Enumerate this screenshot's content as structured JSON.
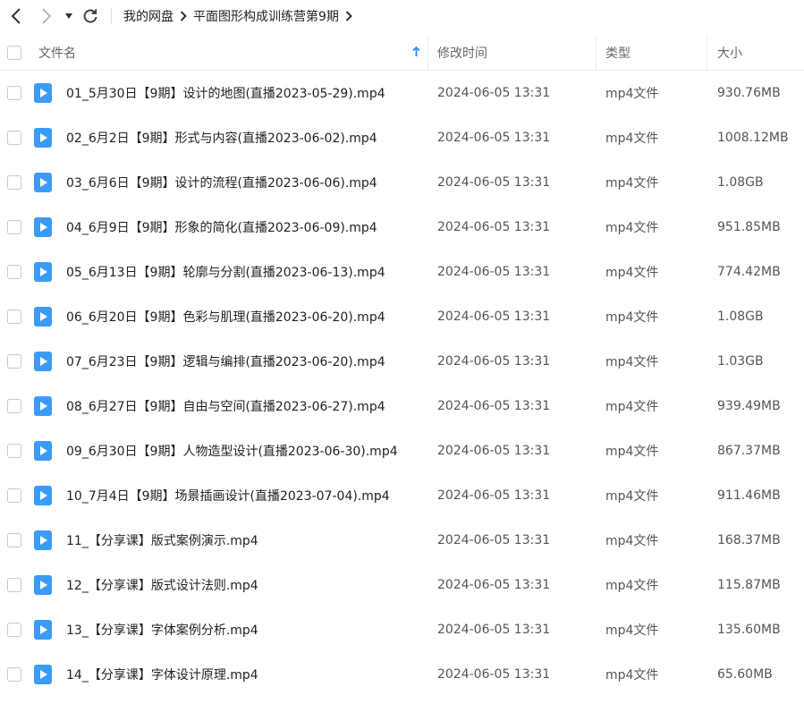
{
  "toolbar": {
    "breadcrumbs": [
      "我的网盘",
      "平面图形构成训练营第9期"
    ]
  },
  "table": {
    "columns": {
      "name": "文件名",
      "modified": "修改时间",
      "type": "类型",
      "size": "大小"
    },
    "sort": {
      "column": "name",
      "direction": "ascending"
    },
    "rows": [
      {
        "name": "01_5月30日【9期】设计的地图(直播2023-05-29).mp4",
        "modified": "2024-06-05 13:31",
        "type": "mp4文件",
        "size": "930.76MB"
      },
      {
        "name": "02_6月2日【9期】形式与内容(直播2023-06-02).mp4",
        "modified": "2024-06-05 13:31",
        "type": "mp4文件",
        "size": "1008.12MB"
      },
      {
        "name": "03_6月6日【9期】设计的流程(直播2023-06-06).mp4",
        "modified": "2024-06-05 13:31",
        "type": "mp4文件",
        "size": "1.08GB"
      },
      {
        "name": "04_6月9日【9期】形象的简化(直播2023-06-09).mp4",
        "modified": "2024-06-05 13:31",
        "type": "mp4文件",
        "size": "951.85MB"
      },
      {
        "name": "05_6月13日【9期】轮廓与分割(直播2023-06-13).mp4",
        "modified": "2024-06-05 13:31",
        "type": "mp4文件",
        "size": "774.42MB"
      },
      {
        "name": "06_6月20日【9期】色彩与肌理(直播2023-06-20).mp4",
        "modified": "2024-06-05 13:31",
        "type": "mp4文件",
        "size": "1.08GB"
      },
      {
        "name": "07_6月23日【9期】逻辑与编排(直播2023-06-20).mp4",
        "modified": "2024-06-05 13:31",
        "type": "mp4文件",
        "size": "1.03GB"
      },
      {
        "name": "08_6月27日【9期】自由与空间(直播2023-06-27).mp4",
        "modified": "2024-06-05 13:31",
        "type": "mp4文件",
        "size": "939.49MB"
      },
      {
        "name": "09_6月30日【9期】人物造型设计(直播2023-06-30).mp4",
        "modified": "2024-06-05 13:31",
        "type": "mp4文件",
        "size": "867.37MB"
      },
      {
        "name": "10_7月4日【9期】场景插画设计(直播2023-07-04).mp4",
        "modified": "2024-06-05 13:31",
        "type": "mp4文件",
        "size": "911.46MB"
      },
      {
        "name": "11_【分享课】版式案例演示.mp4",
        "modified": "2024-06-05 13:31",
        "type": "mp4文件",
        "size": "168.37MB"
      },
      {
        "name": "12_【分享课】版式设计法则.mp4",
        "modified": "2024-06-05 13:31",
        "type": "mp4文件",
        "size": "115.87MB"
      },
      {
        "name": "13_【分享课】字体案例分析.mp4",
        "modified": "2024-06-05 13:31",
        "type": "mp4文件",
        "size": "135.60MB"
      },
      {
        "name": "14_【分享课】字体设计原理.mp4",
        "modified": "2024-06-05 13:31",
        "type": "mp4文件",
        "size": "65.60MB"
      }
    ]
  },
  "colors": {
    "accent": "#2f8ef9",
    "video_icon": "#3b9bfb",
    "text": "#222222",
    "muted": "#666666"
  },
  "icons": {
    "back": "chevron-left-icon",
    "forward": "chevron-right-icon",
    "history": "caret-down-icon",
    "refresh": "refresh-icon",
    "separator": "chevron-right-icon",
    "sort": "arrow-up-icon",
    "file": "video-file-icon"
  }
}
